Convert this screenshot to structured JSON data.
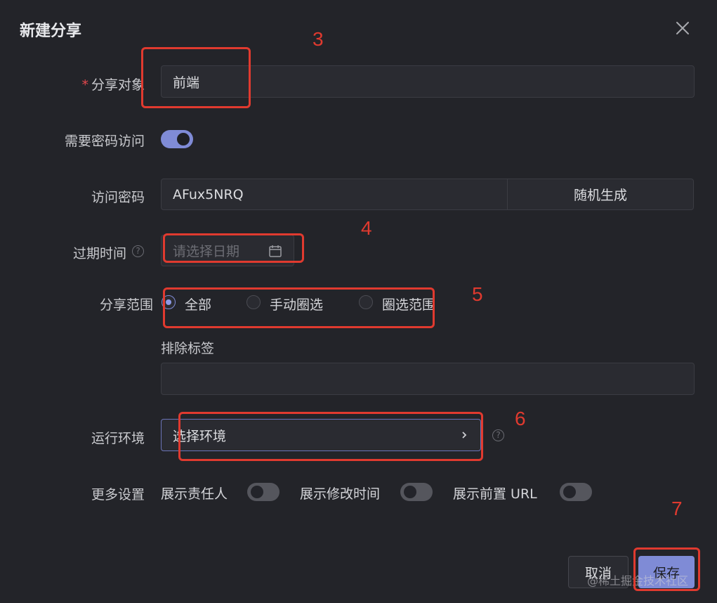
{
  "dialog": {
    "title": "新建分享"
  },
  "share_target": {
    "label": "分享对象",
    "required_mark": "*",
    "value": "前端"
  },
  "password_toggle": {
    "label": "需要密码访问",
    "on": true
  },
  "password": {
    "label": "访问密码",
    "value": "AFux5NRQ",
    "generate_label": "随机生成"
  },
  "expiry": {
    "label": "过期时间",
    "placeholder": "请选择日期",
    "help_mark": "?"
  },
  "scope": {
    "label": "分享范围",
    "options": [
      {
        "label": "全部",
        "selected": true
      },
      {
        "label": "手动圈选",
        "selected": false
      },
      {
        "label": "圈选范围",
        "selected": false
      }
    ]
  },
  "exclude_tags": {
    "label": "排除标签",
    "value": ""
  },
  "environment": {
    "label": "运行环境",
    "value": "选择环境",
    "help_mark": "?"
  },
  "more": {
    "label": "更多设置",
    "toggles": [
      {
        "label": "展示责任人",
        "on": false
      },
      {
        "label": "展示修改时间",
        "on": false
      },
      {
        "label": "展示前置 URL",
        "on": false
      }
    ]
  },
  "footer": {
    "cancel_label": "取消",
    "save_label": "保存"
  },
  "annotations": [
    "3",
    "4",
    "5",
    "6",
    "7"
  ],
  "watermark": "@稀土掘金技术社区",
  "colors": {
    "accent": "#7f8bd6",
    "annotation": "#e03a2f",
    "background": "#232429"
  }
}
